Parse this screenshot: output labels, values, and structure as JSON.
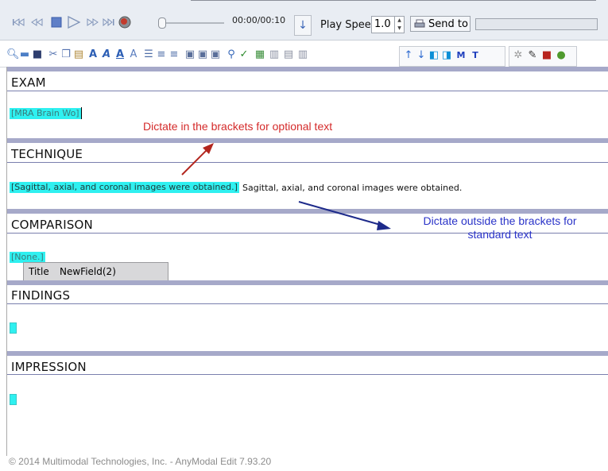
{
  "player": {
    "time": "00:00/00:10",
    "speed_label": "Play Spee",
    "speed_value": "1.0",
    "send_label": "Send to"
  },
  "toolbar": {
    "icons": [
      "search-icon",
      "folder-icon",
      "save-icon",
      "cut-icon",
      "copy-icon",
      "paste-icon",
      "font-a-icon",
      "italic-a-icon",
      "underline-a-icon",
      "outline-a-icon",
      "bullets-icon",
      "indent-icon",
      "outdent-icon",
      "table-icon",
      "field-icon",
      "field-alt-icon",
      "find-icon",
      "spellcheck-icon",
      "grid-icon",
      "merge-icon",
      "split-icon",
      "list-icon",
      "arrow-up-icon",
      "arrow-down-icon",
      "prev-field-icon",
      "next-field-icon",
      "macro-m-icon",
      "template-t-icon",
      "gear-icon",
      "microphone-icon",
      "book-icon",
      "help-icon"
    ]
  },
  "document": {
    "sections": [
      {
        "heading": "EXAM",
        "field": "[MRA Brain Wo]"
      },
      {
        "heading": "TECHNIQUE",
        "field": "[Sagittal, axial, and coronal images were obtained.]",
        "text": "Sagittal, axial, and coronal images were obtained."
      },
      {
        "heading": "COMPARISON",
        "field": "[None.]"
      },
      {
        "heading": "FINDINGS",
        "field": "[]"
      },
      {
        "heading": "IMPRESSION",
        "field": "[]"
      }
    ],
    "tooltip": {
      "col1": "Title",
      "col2": "NewField(2)"
    }
  },
  "annotations": {
    "optional": "Dictate in the brackets for optional text",
    "standard_line1": "Dictate outside the brackets for",
    "standard_line2": "standard text",
    "optional_color": "#d42a2a",
    "standard_color": "#2a33c8"
  },
  "footer": "© 2014 Multimodal Technologies, Inc. - AnyModal Edit 7.93.20"
}
